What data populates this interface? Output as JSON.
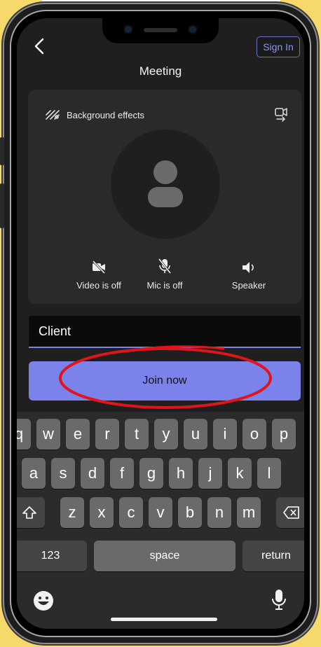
{
  "header": {
    "sign_in_label": "Sign In",
    "title": "Meeting"
  },
  "preview": {
    "background_effects_label": "Background effects",
    "controls": [
      {
        "label": "Video is off"
      },
      {
        "label": "Mic is off"
      },
      {
        "label": "Speaker"
      }
    ]
  },
  "name_input": {
    "value": "Client"
  },
  "join_button": {
    "label": "Join now"
  },
  "keyboard": {
    "row1": [
      "q",
      "w",
      "e",
      "r",
      "t",
      "y",
      "u",
      "i",
      "o",
      "p"
    ],
    "row2": [
      "a",
      "s",
      "d",
      "f",
      "g",
      "h",
      "j",
      "k",
      "l"
    ],
    "row3": [
      "z",
      "x",
      "c",
      "v",
      "b",
      "n",
      "m"
    ],
    "numbers_label": "123",
    "space_label": "space",
    "return_label": "return"
  },
  "icons": {
    "back": "chevron-left-icon",
    "background_effects": "effects-icon",
    "switch_camera": "switch-camera-icon",
    "video_off": "video-off-icon",
    "mic_off": "mic-off-icon",
    "speaker": "speaker-icon",
    "shift": "shift-icon",
    "delete": "backspace-icon",
    "emoji": "emoji-icon",
    "dictation": "microphone-icon"
  },
  "colors": {
    "accent": "#7b83eb",
    "annotation": "#e0141b",
    "background": "#f7d96b"
  }
}
